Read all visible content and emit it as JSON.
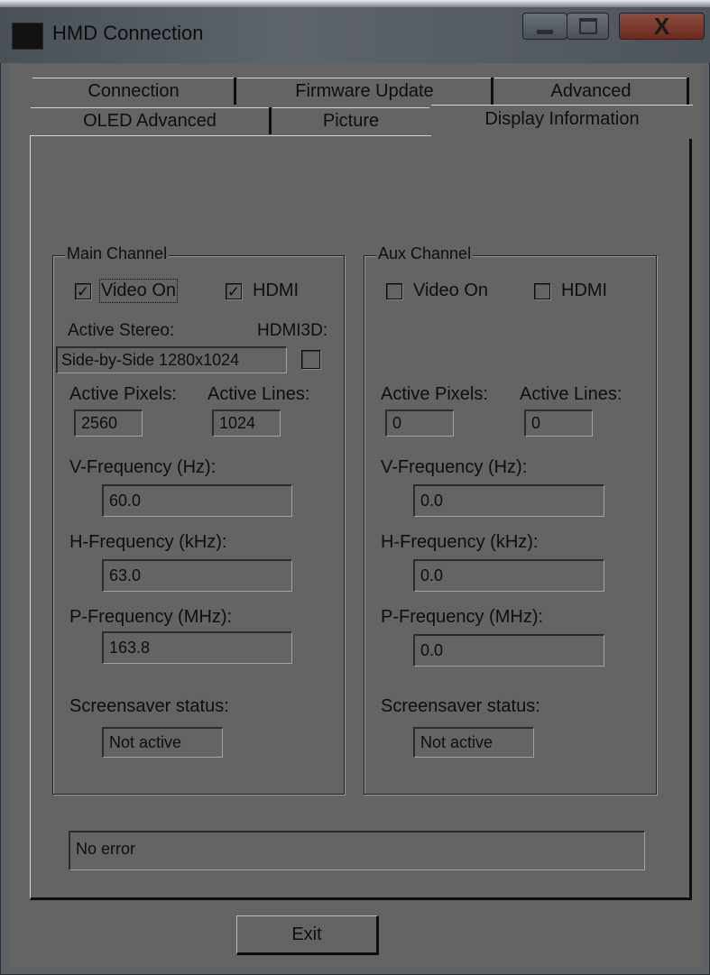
{
  "window": {
    "title": "HMD Connection"
  },
  "tabs": {
    "row1": [
      "Connection",
      "Firmware Update",
      "Advanced"
    ],
    "row2": [
      "OLED Advanced",
      "Picture",
      "Display Information"
    ],
    "active": "Display Information"
  },
  "main_channel": {
    "title": "Main Channel",
    "video_on": {
      "label": "Video On",
      "checked": true
    },
    "hdmi": {
      "label": "HDMI",
      "checked": true
    },
    "active_stereo_label": "Active Stereo:",
    "active_stereo_value": "Side-by-Side 1280x1024",
    "hdmi3d_label": "HDMI3D:",
    "hdmi3d_checked": false,
    "active_pixels_label": "Active Pixels:",
    "active_pixels": "2560",
    "active_lines_label": "Active Lines:",
    "active_lines": "1024",
    "v_freq_label": "V-Frequency (Hz):",
    "v_freq": "60.0",
    "h_freq_label": "H-Frequency (kHz):",
    "h_freq": "63.0",
    "p_freq_label": "P-Frequency (MHz):",
    "p_freq": "163.8",
    "screensaver_label": "Screensaver status:",
    "screensaver": "Not active"
  },
  "aux_channel": {
    "title": "Aux Channel",
    "video_on": {
      "label": "Video On",
      "checked": false
    },
    "hdmi": {
      "label": "HDMI",
      "checked": false
    },
    "active_pixels_label": "Active Pixels:",
    "active_pixels": "0",
    "active_lines_label": "Active Lines:",
    "active_lines": "0",
    "v_freq_label": "V-Frequency (Hz):",
    "v_freq": "0.0",
    "h_freq_label": "H-Frequency (kHz):",
    "h_freq": "0.0",
    "p_freq_label": "P-Frequency (MHz):",
    "p_freq": "0.0",
    "screensaver_label": "Screensaver status:",
    "screensaver": "Not active"
  },
  "status_message": "No error",
  "buttons": {
    "exit": "Exit"
  },
  "icons": {
    "checkmark": "✓"
  }
}
